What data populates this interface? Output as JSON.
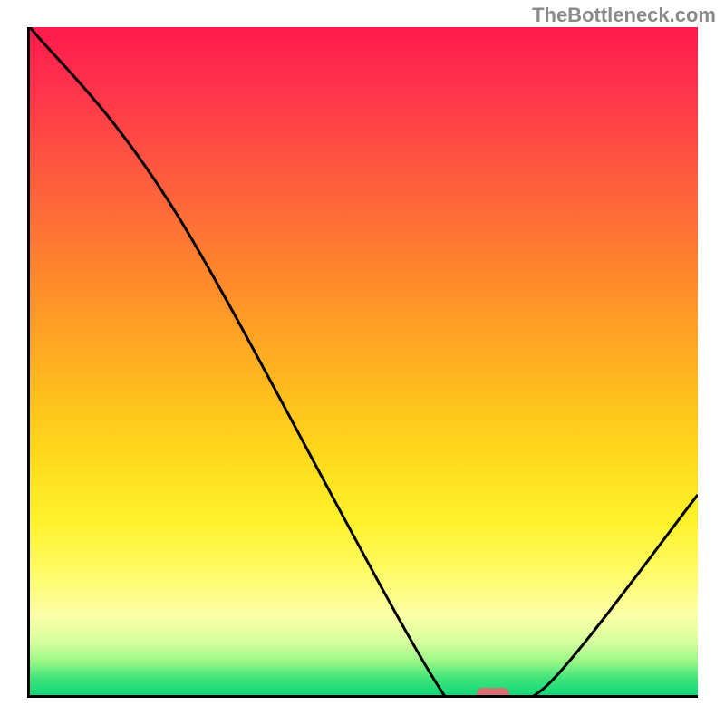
{
  "attribution": "TheBottleneck.com",
  "chart_data": {
    "type": "line",
    "title": "",
    "xlabel": "",
    "ylabel": "",
    "xlim": [
      0,
      100
    ],
    "ylim": [
      0,
      100
    ],
    "series": [
      {
        "name": "curve",
        "x": [
          0,
          22,
          62,
          70,
          78,
          100
        ],
        "y": [
          100,
          72,
          0,
          0,
          2,
          30
        ]
      }
    ],
    "marker": {
      "x": 69,
      "y": 0
    },
    "gradient_stops": [
      {
        "pos": 0,
        "color": "#ff1a4b"
      },
      {
        "pos": 8,
        "color": "#ff2f4c"
      },
      {
        "pos": 22,
        "color": "#ff5a3f"
      },
      {
        "pos": 38,
        "color": "#ff8a2b"
      },
      {
        "pos": 52,
        "color": "#ffb51f"
      },
      {
        "pos": 64,
        "color": "#ffd91a"
      },
      {
        "pos": 74,
        "color": "#fff22a"
      },
      {
        "pos": 82,
        "color": "#fffb6a"
      },
      {
        "pos": 88,
        "color": "#fcffa6"
      },
      {
        "pos": 92,
        "color": "#d7ff9e"
      },
      {
        "pos": 95,
        "color": "#98f786"
      },
      {
        "pos": 97.5,
        "color": "#3fe47a"
      },
      {
        "pos": 100,
        "color": "#11d977"
      }
    ]
  }
}
